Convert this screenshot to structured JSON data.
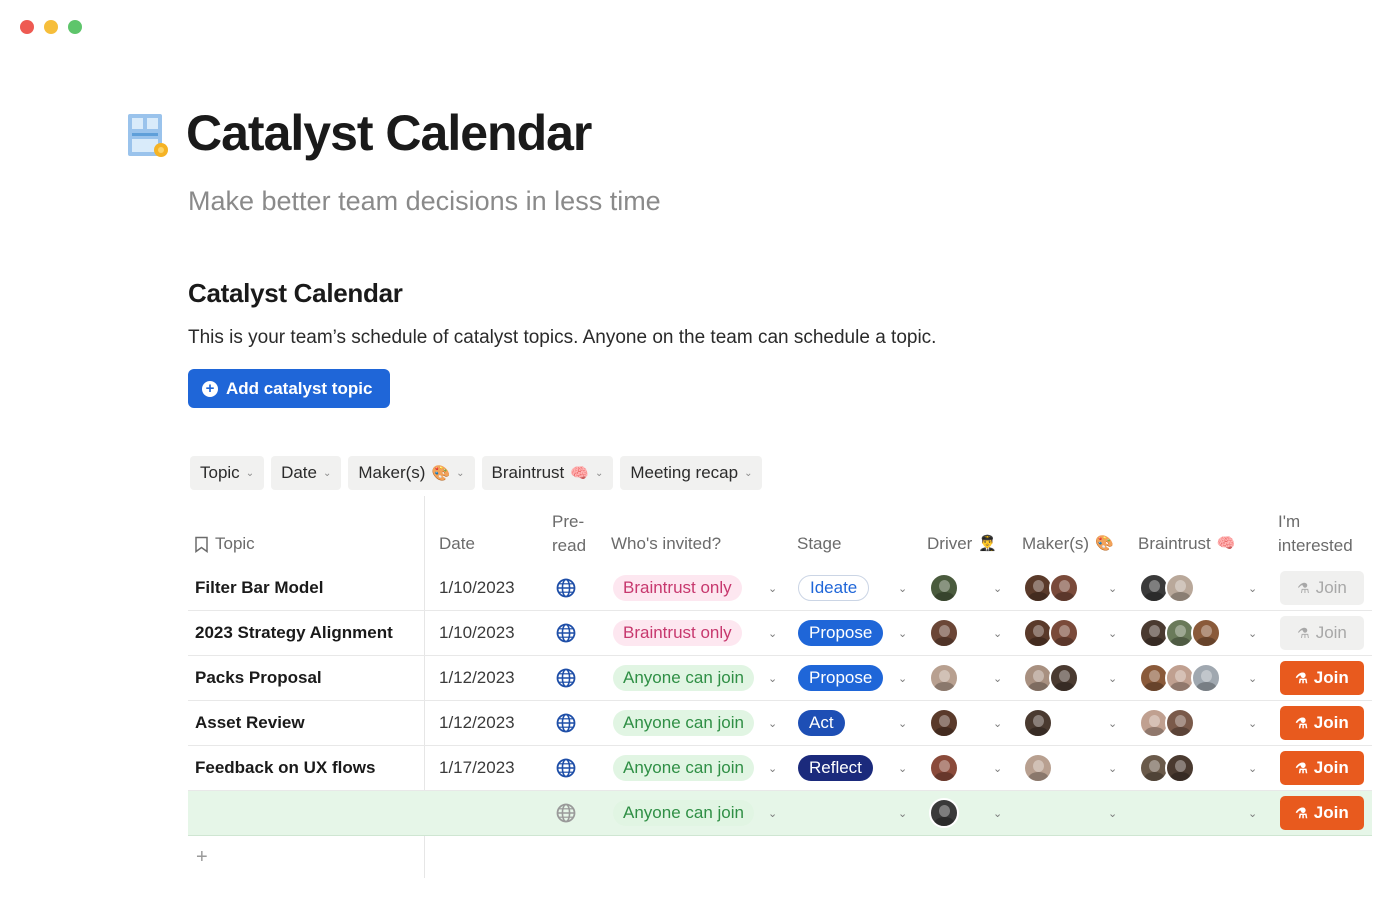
{
  "window": {
    "dots": [
      "red",
      "yellow",
      "green"
    ]
  },
  "page": {
    "icon": "calendar-icon",
    "title": "Catalyst Calendar",
    "subtitle": "Make better team decisions in less time"
  },
  "section": {
    "title": "Catalyst Calendar",
    "description": "This is your team’s schedule of catalyst topics. Anyone on the team can schedule a topic.",
    "add_button_label": "Add catalyst topic"
  },
  "filters": [
    {
      "label": "Topic",
      "emoji": ""
    },
    {
      "label": "Date",
      "emoji": ""
    },
    {
      "label": "Maker(s)",
      "emoji": "🎨"
    },
    {
      "label": "Braintrust",
      "emoji": "🧠"
    },
    {
      "label": "Meeting recap",
      "emoji": ""
    }
  ],
  "table": {
    "headers": {
      "topic": "Topic",
      "date": "Date",
      "preread_line1": "Pre-",
      "preread_line2": "read",
      "invited": "Who's invited?",
      "stage": "Stage",
      "driver": "Driver",
      "driver_emoji": "👨‍✈️",
      "makers": "Maker(s)",
      "makers_emoji": "🎨",
      "braintrust": "Braintrust",
      "braintrust_emoji": "🧠",
      "interested_line1": "I'm",
      "interested_line2": "interested"
    },
    "rows": [
      {
        "topic": "Filter Bar Model",
        "date": "1/10/2023",
        "invited": "Braintrust only",
        "invited_type": "braintrust",
        "stage": "Ideate",
        "stage_type": "ideate",
        "driver": [
          "#4a5b3d"
        ],
        "makers": [
          "#5a3a2a",
          "#7a4a3a"
        ],
        "braintrust": [
          "#3a3a3a",
          "#b9a89a"
        ],
        "join": "Join",
        "join_state": "disabled"
      },
      {
        "topic": "2023 Strategy Alignment",
        "date": "1/10/2023",
        "invited": "Braintrust only",
        "invited_type": "braintrust",
        "stage": "Propose",
        "stage_type": "propose",
        "driver": [
          "#6b4636"
        ],
        "makers": [
          "#5a3a2a",
          "#7a4a3a"
        ],
        "braintrust": [
          "#4a3a30",
          "#6a7a5a",
          "#8a5a3a"
        ],
        "join": "Join",
        "join_state": "disabled"
      },
      {
        "topic": "Packs Proposal",
        "date": "1/12/2023",
        "invited": "Anyone can join",
        "invited_type": "anyone",
        "stage": "Propose",
        "stage_type": "propose",
        "driver": [
          "#b8a090"
        ],
        "makers": [
          "#a89080",
          "#4a3a30"
        ],
        "braintrust": [
          "#8a5a3a",
          "#c0a090",
          "#a0a8b0"
        ],
        "join": "Join",
        "join_state": "active"
      },
      {
        "topic": "Asset Review",
        "date": "1/12/2023",
        "invited": "Anyone can join",
        "invited_type": "anyone",
        "stage": "Act",
        "stage_type": "act",
        "driver": [
          "#5a3a2a"
        ],
        "makers": [
          "#4a3a30"
        ],
        "braintrust": [
          "#c0a090",
          "#7a5a4a"
        ],
        "join": "Join",
        "join_state": "active"
      },
      {
        "topic": "Feedback on UX flows",
        "date": "1/17/2023",
        "invited": "Anyone can join",
        "invited_type": "anyone",
        "stage": "Reflect",
        "stage_type": "reflect",
        "driver": [
          "#8a4a3a"
        ],
        "makers": [
          "#b8a090"
        ],
        "braintrust": [
          "#6a5a4a",
          "#4a3a30"
        ],
        "join": "Join",
        "join_state": "active"
      },
      {
        "topic": "",
        "date": "",
        "invited": "Anyone can join",
        "invited_type": "anyone",
        "stage": "",
        "stage_type": "",
        "driver": [
          "#3a3a3a"
        ],
        "makers": [],
        "braintrust": [],
        "join": "Join",
        "join_state": "active",
        "highlight": true
      }
    ],
    "add_row_label": "+"
  }
}
